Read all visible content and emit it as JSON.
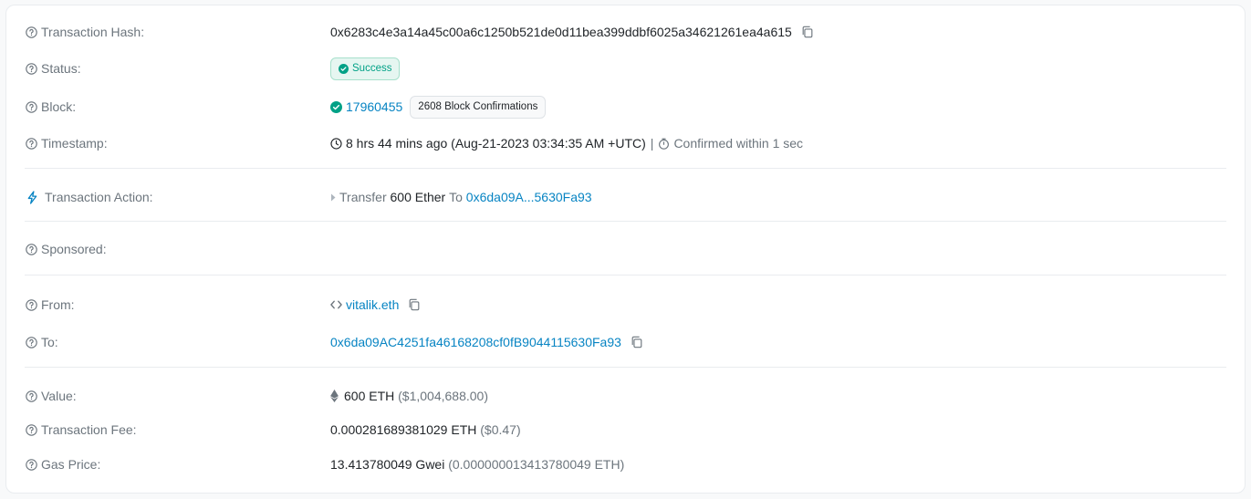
{
  "rows": {
    "hash": {
      "label": "Transaction Hash:",
      "value": "0x6283c4e3a14a45c00a6c1250b521de0d11bea399ddbf6025a34621261ea4a615"
    },
    "status": {
      "label": "Status:",
      "badge": "Success"
    },
    "block": {
      "label": "Block:",
      "number": "17960455",
      "confirmations": "2608 Block Confirmations"
    },
    "timestamp": {
      "label": "Timestamp:",
      "value": "8 hrs 44 mins ago (Aug-21-2023 03:34:35 AM +UTC)",
      "separator": "|",
      "confirmed": "Confirmed within 1 sec"
    },
    "action": {
      "label": "Transaction Action:",
      "verb": "Transfer",
      "amount": "600 Ether",
      "to_word": "To",
      "to_addr": "0x6da09A...5630Fa93"
    },
    "sponsored": {
      "label": "Sponsored:"
    },
    "from": {
      "label": "From:",
      "value": "vitalik.eth"
    },
    "to": {
      "label": "To:",
      "value": "0x6da09AC4251fa46168208cf0fB9044115630Fa93"
    },
    "value": {
      "label": "Value:",
      "eth": "600 ETH",
      "usd": "($1,004,688.00)"
    },
    "fee": {
      "label": "Transaction Fee:",
      "eth": "0.000281689381029 ETH",
      "usd": "($0.47)"
    },
    "gas": {
      "label": "Gas Price:",
      "gwei": "13.413780049 Gwei",
      "eth": "(0.000000013413780049 ETH)"
    }
  },
  "colors": {
    "link": "#0784c3",
    "success": "#00a186",
    "muted": "#6c757d"
  },
  "icons": {
    "help": "question-circle-icon",
    "copy": "copy-icon",
    "success": "check-circle-icon",
    "clock": "clock-icon",
    "stopwatch": "stopwatch-icon",
    "lightning": "lightning-icon",
    "caret": "caret-right-icon",
    "code": "code-brackets-icon",
    "eth": "ethereum-icon"
  }
}
